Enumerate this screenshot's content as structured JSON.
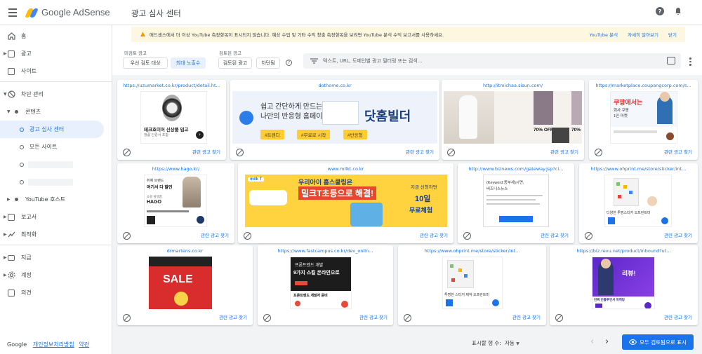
{
  "app": {
    "brand": "Google AdSense",
    "page_title": "광고 심사 센터"
  },
  "sidebar": {
    "items": [
      {
        "label": "홈"
      },
      {
        "label": "광고"
      },
      {
        "label": "사이트"
      },
      {
        "label": "차단 관리"
      },
      {
        "label": "콘텐츠"
      },
      {
        "label": "광고 심사 센터"
      },
      {
        "label": "모든 사이트"
      },
      {
        "label": "YouTube 호스트"
      },
      {
        "label": "보고서"
      },
      {
        "label": "최적화"
      },
      {
        "label": "지급"
      },
      {
        "label": "계정"
      },
      {
        "label": "의견"
      }
    ],
    "footer": {
      "brand": "Google",
      "privacy": "개인정보처리방침",
      "terms": "약관"
    }
  },
  "banner": {
    "message": "애드센스에서 더 이상 YouTube 측정항목이 표시되지 않습니다. 예상 수입 및 기타 수익 창출 측정항목을 보려면 YouTube 분석 수익 보고서를 사용하세요.",
    "links": [
      "YouTube 분석",
      "자세히 알아보기",
      "닫기"
    ]
  },
  "filters": {
    "unreviewed_label": "미검토 광고",
    "unreviewed_chips": [
      "우선 검토 대상",
      "최대 노출수"
    ],
    "reviewed_label": "검토된 광고",
    "reviewed_chips": [
      "검토된 광고",
      "차단됨"
    ],
    "search_placeholder": "텍스트, URL, 도메인별 광고 필터링 또는 검색..."
  },
  "related_label": "관련 광고 찾기",
  "ads": [
    {
      "url": "https://uzumarket.co.kr/product/detail.ht...",
      "texts": [
        "데크호이어 신상품 입고",
        "정품 인증서 포함"
      ]
    },
    {
      "url": "dothome.co.kr",
      "texts": [
        "쉽고 간단하게 만드는",
        "나만의 반응형 홈페이지",
        "닷홈빌더",
        "#트렌디",
        "#무료로 시작",
        "#반응형"
      ]
    },
    {
      "url": "http://itmichaa.sisun.com/",
      "texts": [
        "70% OFF",
        "70% OFF",
        "70%"
      ]
    },
    {
      "url": "https://marketplace.coupangcorp.com/s...",
      "texts": [
        "쿠팡에서는",
        "회사 쿠팡",
        "1인 마켓"
      ]
    },
    {
      "url": "https://www.hago.kr/",
      "texts": [
        "취예 브랜드",
        "여기서 다 할인",
        "쇼핑 플랫폼",
        "HAGO"
      ]
    },
    {
      "url": "www.milkt.co.kr",
      "texts": [
        "milk T",
        "우리아이 홈스쿨링은",
        "밀크T초등으로 해결!",
        "지금 신청하면",
        "10일",
        "무료체험"
      ]
    },
    {
      "url": "http://www.biznews.com/gateway.jsp?ci...",
      "texts": [
        "(Keyword:종부세)시면,",
        "비즈니스뉴스"
      ]
    },
    {
      "url": "https://www.ohprint.me/store/sticker/int...",
      "texts": [
        "다양한 투명스티커 오프린트미"
      ]
    },
    {
      "url": "drmartens.co.kr",
      "texts": [
        "SALE"
      ]
    },
    {
      "url": "https://www.fastcampus.co.kr/dev_onlin...",
      "texts": [
        "프론트엔드 개발",
        "9가지 스킬 온라인으로",
        "프론트엔드 개발자 준비"
      ]
    },
    {
      "url": "https://www.ohprint.me/store/sticker/int...",
      "texts": [
        "투명한 스티커 제작 오프린트미"
      ]
    },
    {
      "url": "https://biz.revu.net/product/inbound?ut...",
      "texts": [
        "리뷰!",
        "진짜 인플루언서 마케팅"
      ]
    }
  ],
  "footer": {
    "rows_label": "표시할 행 수:",
    "rows_value": "자동",
    "review_all": "모두 검토됨으로 표시"
  },
  "colors": {
    "accent": "#1a73e8",
    "background": "#f1f3f4",
    "banner": "#fef7e0"
  },
  "icons": [
    "menu-icon",
    "help-icon",
    "bell-icon",
    "home-icon",
    "block-icon",
    "search-icon",
    "visibility-icon"
  ]
}
